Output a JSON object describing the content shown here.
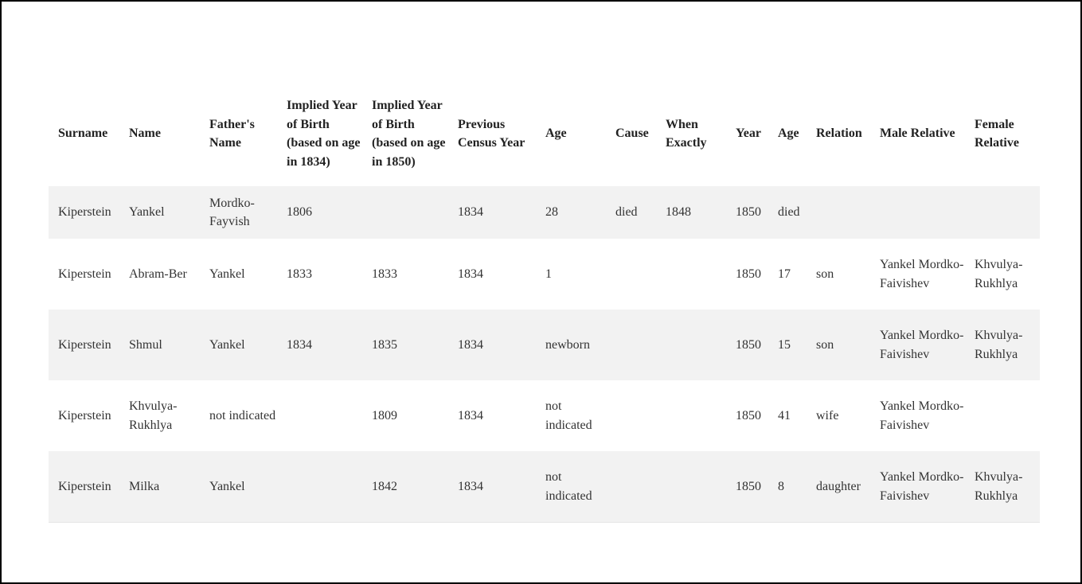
{
  "columns": [
    "Surname",
    "Name",
    "Father's Name",
    "Implied Year of Birth (based on age in 1834)",
    "Implied Year of Birth (based on age in 1850)",
    "Previous Census Year",
    "Age",
    "Cause",
    "When Exactly",
    "Year",
    "Age",
    "Relation",
    "Male Relative",
    "Female Relative"
  ],
  "rows": [
    [
      "Kiperstein",
      "Yankel",
      "Mordko-Fayvish",
      "1806",
      "",
      "1834",
      "28",
      "died",
      "1848",
      "1850",
      "died",
      "",
      "",
      ""
    ],
    [
      "Kiperstein",
      "Abram-Ber",
      "Yankel",
      "1833",
      "1833",
      "1834",
      "1",
      "",
      "",
      "1850",
      "17",
      "son",
      "Yankel Mordko-Faivishev",
      "Khvulya-Rukhlya"
    ],
    [
      "Kiperstein",
      "Shmul",
      "Yankel",
      "1834",
      "1835",
      "1834",
      "newborn",
      "",
      "",
      "1850",
      "15",
      "son",
      "Yankel Mordko-Faivishev",
      "Khvulya-Rukhlya"
    ],
    [
      "Kiperstein",
      "Khvulya-Rukhlya",
      "not indicated",
      "",
      "1809",
      "1834",
      "not indicated",
      "",
      "",
      "1850",
      "41",
      "wife",
      "Yankel Mordko-Faivishev",
      ""
    ],
    [
      "Kiperstein",
      "Milka",
      "Yankel",
      "",
      "1842",
      "1834",
      "not indicated",
      "",
      "",
      "1850",
      "8",
      "daughter",
      "Yankel Mordko-Faivishev",
      "Khvulya-Rukhlya"
    ]
  ],
  "colors": {
    "border": "#000000",
    "row_shade": "#f2f2f2",
    "text": "#333333"
  }
}
